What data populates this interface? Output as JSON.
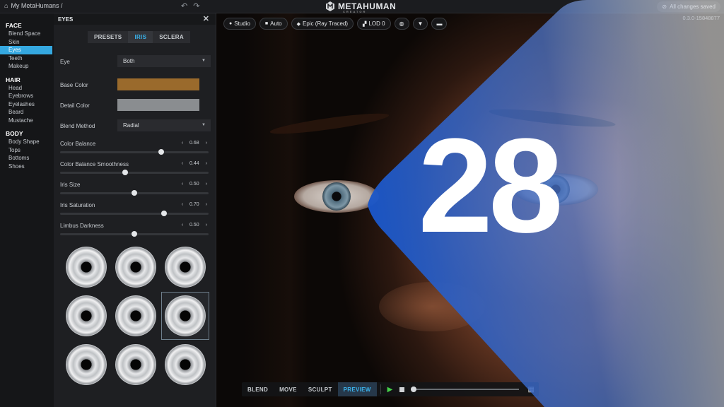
{
  "topbar": {
    "breadcrumb": "My MetaHumans /",
    "app_title": "METAHUMAN",
    "app_subtitle": "CREATOR",
    "save_status": "All changes saved"
  },
  "nav": {
    "sections": [
      {
        "title": "FACE",
        "items": [
          "Blend Space",
          "Skin",
          "Eyes",
          "Teeth",
          "Makeup"
        ]
      },
      {
        "title": "HAIR",
        "items": [
          "Head",
          "Eyebrows",
          "Eyelashes",
          "Beard",
          "Mustache"
        ]
      },
      {
        "title": "BODY",
        "items": [
          "Body Shape",
          "Tops",
          "Bottoms",
          "Shoes"
        ]
      }
    ],
    "active_item": "Eyes"
  },
  "panel": {
    "title": "EYES",
    "tabs": [
      "PRESETS",
      "IRIS",
      "SCLERA"
    ],
    "active_tab": "IRIS",
    "eye_label": "Eye",
    "eye_value": "Both",
    "base_color_label": "Base Color",
    "base_color": "#9a6a2c",
    "detail_color_label": "Detail Color",
    "detail_color": "#8a8d90",
    "blend_method_label": "Blend Method",
    "blend_method_value": "Radial",
    "sliders": [
      {
        "label": "Color Balance",
        "value": "0.68",
        "level": 0.68
      },
      {
        "label": "Color Balance Smoothness",
        "value": "0.44",
        "level": 0.44
      },
      {
        "label": "Iris Size",
        "value": "0.50",
        "level": 0.5
      },
      {
        "label": "Iris Saturation",
        "value": "0.70",
        "level": 0.7
      },
      {
        "label": "Limbus Darkness",
        "value": "0.50",
        "level": 0.5
      }
    ],
    "iris_presets_selected": 6
  },
  "viewport": {
    "tools": [
      {
        "icon": "lightbulb-icon",
        "label": "Studio"
      },
      {
        "icon": "camera-icon",
        "label": "Auto"
      },
      {
        "icon": "diamond-icon",
        "label": "Epic (Ray Traced)"
      },
      {
        "icon": "lod-icon",
        "label": "LOD 0"
      }
    ],
    "version": "0.3.0-15848877",
    "modes": [
      "BLEND",
      "MOVE",
      "SCULPT",
      "PREVIEW"
    ],
    "active_mode": "PREVIEW",
    "timeline_progress": 0.0
  },
  "overlay": {
    "number": "28",
    "gradient_start": "#1a56c8",
    "gradient_end": "#ffffff"
  }
}
